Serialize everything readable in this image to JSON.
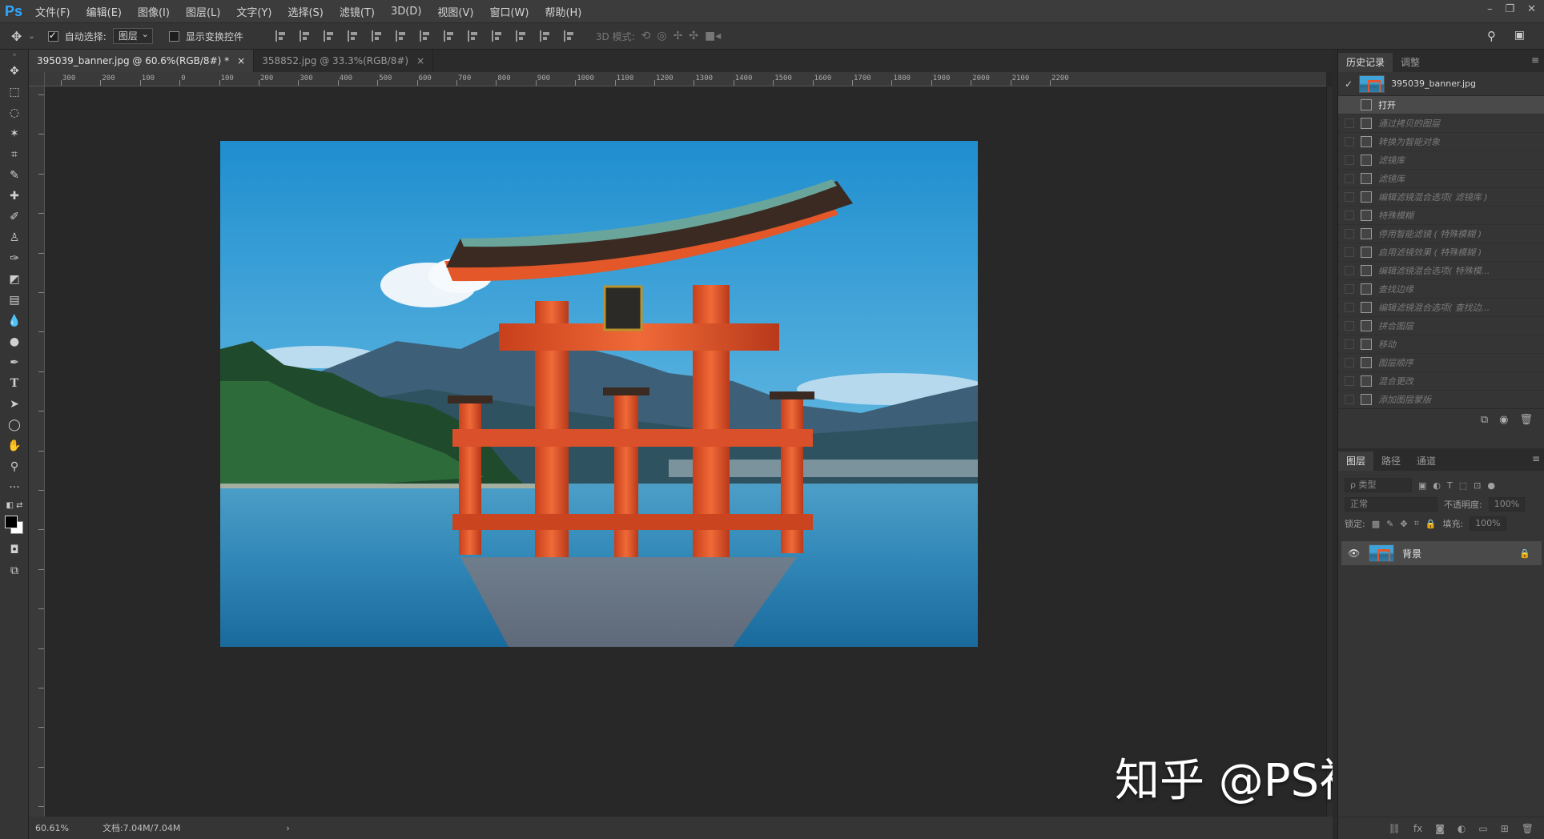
{
  "app": {
    "logo": "Ps"
  },
  "menu": [
    "文件(F)",
    "编辑(E)",
    "图像(I)",
    "图层(L)",
    "文字(Y)",
    "选择(S)",
    "滤镜(T)",
    "3D(D)",
    "视图(V)",
    "窗口(W)",
    "帮助(H)"
  ],
  "window_controls": [
    "–",
    "❐",
    "✕"
  ],
  "options": {
    "auto_select_label": "自动选择:",
    "auto_select_value": "图层",
    "show_transform_label": "显示变换控件",
    "mode_3d_label": "3D 模式:"
  },
  "tabs": [
    {
      "title": "395039_banner.jpg @ 60.6%(RGB/8#) *",
      "close": "×"
    },
    {
      "title": "358852.jpg @ 33.3%(RGB/8#)",
      "close": "×"
    }
  ],
  "ruler_top": [
    "300",
    "200",
    "100",
    "0",
    "100",
    "200",
    "300",
    "400",
    "500",
    "600",
    "700",
    "800",
    "900",
    "1000",
    "1100",
    "1200",
    "1300",
    "1400",
    "1500",
    "1600",
    "1700",
    "1800",
    "1900",
    "2000",
    "2100",
    "2200"
  ],
  "status": {
    "zoom": "60.61%",
    "doc": "文档:7.04M/7.04M"
  },
  "watermark": "知乎 @PS视觉设计",
  "history": {
    "tabs": [
      "历史记录",
      "调整"
    ],
    "snapshot": "395039_banner.jpg",
    "items": [
      "打开",
      "通过拷贝的图层",
      "转换为智能对象",
      "滤镜库",
      "滤镜库",
      "编辑滤镜混合选项( 滤镜库 )",
      "特殊模糊",
      "停用智能滤镜 ( 特殊模糊 )",
      "启用滤镜效果 ( 特殊模糊 )",
      "编辑滤镜混合选项( 特殊模...",
      "查找边缘",
      "编辑滤镜混合选项( 查找边...",
      "拼合图层",
      "移动",
      "图层顺序",
      "混合更改",
      "添加图层蒙版"
    ],
    "active_index": 0
  },
  "layers": {
    "tabs": [
      "图层",
      "路径",
      "通道"
    ],
    "kind_placeholder": "ρ 类型",
    "blend_mode": "正常",
    "opacity_label": "不透明度:",
    "opacity_value": "100%",
    "lock_label": "锁定:",
    "fill_label": "填充:",
    "fill_value": "100%",
    "layer_name": "背景"
  }
}
